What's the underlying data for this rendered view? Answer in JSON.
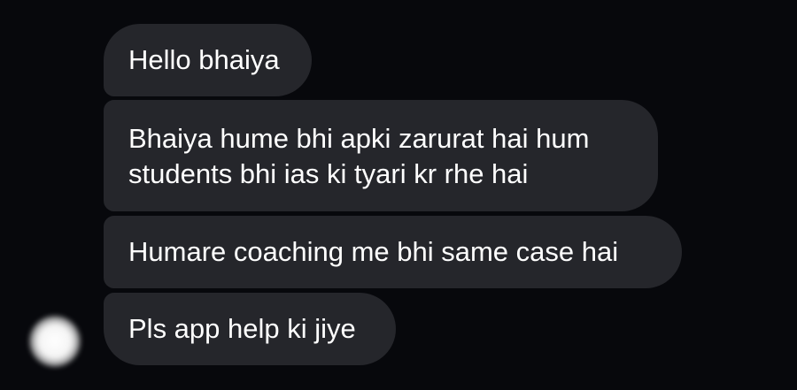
{
  "colors": {
    "background": "#07080c",
    "bubble": "#25262b",
    "text": "#ffffff"
  },
  "avatar": {
    "icon": "blurred-avatar"
  },
  "messages": [
    {
      "lines": [
        "Hello bhaiya"
      ]
    },
    {
      "lines": [
        "Bhaiya hume bhi apki zarurat hai hum",
        "students bhi ias ki tyari kr rhe hai"
      ]
    },
    {
      "lines": [
        "Humare coaching me bhi same case hai"
      ]
    },
    {
      "lines": [
        "Pls app help ki jiye"
      ]
    }
  ]
}
